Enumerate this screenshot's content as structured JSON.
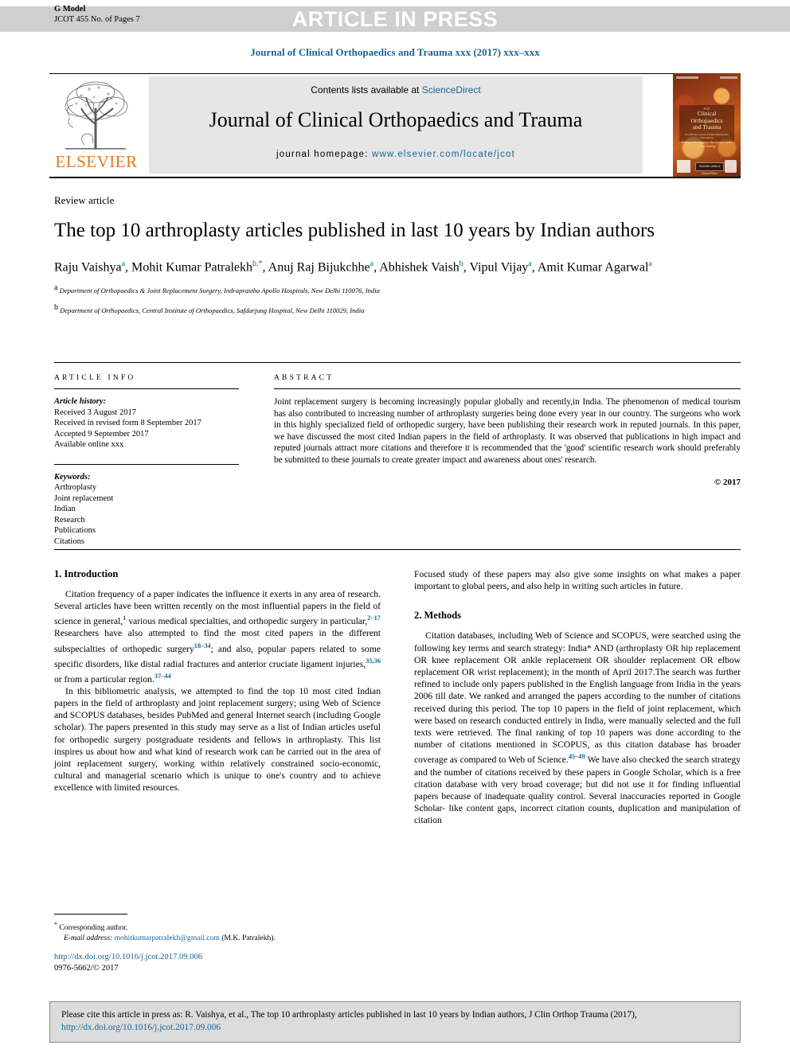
{
  "banner": {
    "press_text": "ARTICLE IN PRESS",
    "g_model": "G Model",
    "manuscript_id": "JCOT 455 No. of Pages 7"
  },
  "running_head": "Journal of Clinical Orthopaedics and Trauma xxx (2017) xxx–xxx",
  "masthead": {
    "contents_prefix": "Contents lists available at",
    "contents_link": "ScienceDirect",
    "journal_name": "Journal of Clinical Orthopaedics and Trauma",
    "homepage_label": "journal homepage:",
    "homepage_url": "www.elsevier.com/locate/jcot",
    "publisher": "ELSEVIER",
    "cover": {
      "tiny_top": "ISSN 0976-5662",
      "line0": "JCOT",
      "line1": "Clinical Orthopaedics",
      "line2": "and Trauma",
      "subtitle": "An Official Journal of Delhi Orthopaedic Association",
      "quote": "Orthopaedic surgery - the science of the art of healing",
      "badge": "Available online at ScienceDirect"
    }
  },
  "article": {
    "kind": "Review article",
    "title": "The top 10 arthroplasty articles published in last 10 years by Indian authors",
    "authors_html": "Raju Vaishya<sup>a</sup>, Mohit Kumar Patralekh<sup>b,*</sup>, Anuj Raj Bijukchhe<sup>a</sup>, Abhishek Vaish<sup>b</sup>, Vipul Vijay<sup>a</sup>, Amit Kumar Agarwal<sup>a</sup>",
    "affiliation_a": "Department of Orthopaedics & Joint Replacement Surgery, Indraprastha Apollo Hospitals, New Delhi 110076, India",
    "affiliation_b": "Department of Orthopaedics, Central Institute of Orthopaedics, Safdarjung Hospital, New Delhi 110029, India"
  },
  "info": {
    "heading": "ARTICLE INFO",
    "history_label": "Article history:",
    "history": [
      "Received 3 August 2017",
      "Received in revised form 8 September 2017",
      "Accepted 9 September 2017",
      "Available online xxx"
    ],
    "keywords_label": "Keywords:",
    "keywords": [
      "Arthroplasty",
      "Joint replacement",
      "Indian",
      "Research",
      "Publications",
      "Citations"
    ]
  },
  "abstract": {
    "heading": "ABSTRACT",
    "text": "Joint replacement surgery is becoming increasingly popular globally and recently,in India. The phenomenon of medical tourism has also contributed to increasing number of arthroplasty surgeries being done every year in our country. The surgeons who work in this highly specialized field of orthopedic surgery, have been publishing their research work in reputed journals. In this paper, we have discussed the most cited Indian papers in the field of arthroplasty. It was observed that publications in high impact and reputed journals attract more citations and therefore it is recommended that the 'good' scientific research work should preferably be submitted to these journals to create greater impact and awareness about ones' research.",
    "copyright": "© 2017"
  },
  "body": {
    "intro_heading": "1. Introduction",
    "intro_p1_html": "Citation frequency of a paper indicates the influence it exerts in any area of research. Several articles have been written recently on the most influential papers in the field of science in general,<sup>1</sup> various medical specialties, and orthopedic surgery in particular,<sup>2&#8211;17</sup> Researchers have also attempted to find the most cited papers in the different subspecialties of orthopedic surgery<sup>18&#8211;34</sup>; and also, popular papers related to some specific disorders, like distal radial fractures and anterior cruciate ligament injuries,<sup>35,36</sup> or from a particular region.<sup>37&#8211;44</sup>",
    "intro_p2": "In this bibliometric analysis, we attempted to find the top 10 most cited Indian papers in the field of arthroplasty and joint replacement surgery; using Web of Science and SCOPUS databases, besides PubMed and general Internet search (including Google scholar). The papers presented in this study may serve as a list of Indian articles useful for orthopedic surgery postgraduate residents and fellows in arthroplasty. This list inspires us about how and what kind of research work can be carried out in the area of joint replacement surgery, working within relatively constrained socio-economic, cultural and managerial scenario which is unique to one's country and to achieve excellence with limited resources.",
    "right_p1": "Focused study of these papers may also give some insights on what makes a paper important to global peers, and also help in writing such articles in future.",
    "methods_heading": "2. Methods",
    "methods_p1_html": "Citation databases, including Web of Science and SCOPUS, were searched using the following key terms and search strategy: India* AND (arthroplasty OR hip replacement OR knee replacement OR ankle replacement OR shoulder replacement OR elbow replacement OR wrist replacement); in the month of April 2017.The search was further refined to include only papers published in the English language from India in the years 2006 till date. We ranked and arranged the papers according to the number of citations received during this period. The top 10 papers in the field of joint replacement, which were based on research conducted entirely in India, were manually selected and the full texts were retrieved. The final ranking of top 10 papers was done according to the number of citations mentioned in SCOPUS, as this citation database has broader coverage as compared to Web of Science.<sup>45&#8211;49</sup> We have also checked the search strategy and the number of citations received by these papers in Google Scholar, which is a free citation database with very broad coverage; but did not use it for finding influential papers because of inadequate quality control. Several inaccuracies reported in Google Scholar- like content gaps, incorrect citation counts, duplication and manipulation of citation"
  },
  "footnote": {
    "marker": "*",
    "corresponding": "Corresponding author.",
    "email_label": "E-mail address:",
    "email": "mohitkumarpatralekh@gmail.com",
    "email_owner": "(M.K. Patralekh).",
    "doi": "http://dx.doi.org/10.1016/j.jcot.2017.09.006",
    "issn": "0976-5662/© 2017"
  },
  "cite_box": {
    "text_before": "Please cite this article in press as: R. Vaishya, et al., The top 10 arthroplasty articles published in last 10 years by Indian authors, J Clin Orthop Trauma (2017), ",
    "doi": "http://dx.doi.org/10.1016/j.jcot.2017.09.006"
  },
  "colors": {
    "link": "#1a6496",
    "elsevier_orange": "#e87722",
    "banner_gray": "#cfcfcf",
    "box_gray": "#e6e6e6",
    "cite_gray": "#dcdcdc"
  }
}
